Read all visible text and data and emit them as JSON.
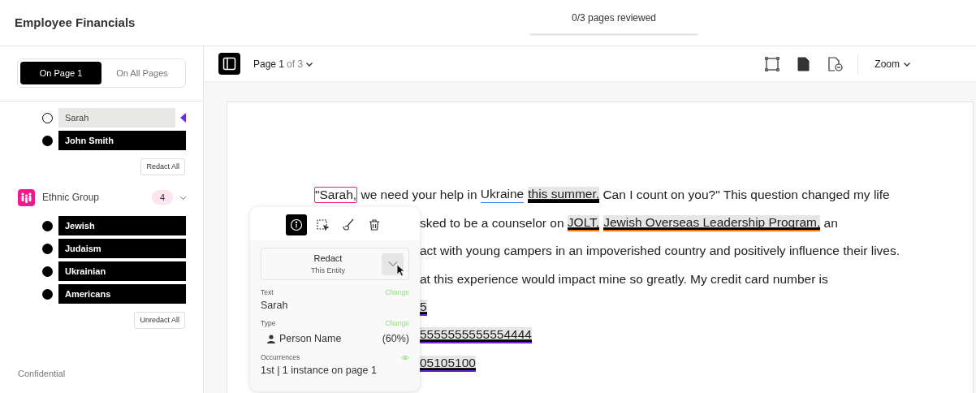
{
  "header": {
    "title": "Employee Financials",
    "review": {
      "label": "0/3 pages reviewed",
      "level": 0
    }
  },
  "sidebar": {
    "scope_tabs": [
      {
        "label": "On Page 1",
        "selected": true
      },
      {
        "label": "On All Pages",
        "selected": false
      }
    ],
    "groups": [
      {
        "items": [
          {
            "label": "Sarah",
            "redacted": false,
            "current": true
          },
          {
            "label": "John Smith",
            "redacted": true,
            "current": false
          }
        ],
        "action": "Redact All"
      },
      {
        "title": "Ethnic Group",
        "count": "4",
        "expanded": true,
        "items": [
          {
            "label": "Jewish",
            "redacted": true,
            "current": false
          },
          {
            "label": "Judaism",
            "redacted": true,
            "current": false
          },
          {
            "label": "Ukrainian",
            "redacted": true,
            "current": false
          },
          {
            "label": "Americans",
            "redacted": true,
            "current": false
          }
        ],
        "action": "Unredact All"
      }
    ],
    "footer": "Confidential"
  },
  "toolbar": {
    "page": "Page 1",
    "of": "of 3",
    "zoom": "Zoom"
  },
  "document": {
    "lines": [
      {
        "covered": false,
        "segments": [
          {
            "kind": "entity",
            "text": "\"Sarah,",
            "selected": true,
            "shaded": false,
            "color": "#e91e8c"
          },
          {
            "kind": "text",
            "text": " we need your help in "
          },
          {
            "kind": "entity",
            "text": "Ukraine",
            "selected": false,
            "shaded": false,
            "color": "#3b82f6"
          },
          {
            "kind": "entity",
            "text": "this summer,",
            "selected": false,
            "shaded": true,
            "color": "#000000"
          },
          {
            "kind": "text",
            "text": " Can I count on you?\" This question changed my life"
          }
        ]
      },
      {
        "covered": true,
        "segments": [
          {
            "kind": "text",
            "text": "sked to be a counselor on "
          },
          {
            "kind": "entity",
            "text": "JOLT,",
            "selected": false,
            "shaded": true,
            "color": "#f97316"
          },
          {
            "kind": "entity",
            "text": "Jewish Overseas Leadership Program,",
            "selected": false,
            "shaded": true,
            "color": "#f97316"
          },
          {
            "kind": "text",
            "text": " an"
          }
        ]
      },
      {
        "covered": true,
        "segments": [
          {
            "kind": "text",
            "text": "act with young campers in an impoverished country and positively influence their lives."
          }
        ]
      },
      {
        "covered": true,
        "segments": [
          {
            "kind": "text",
            "text": "at this experience would impact mine so greatly. My credit card number is"
          }
        ]
      },
      {
        "covered": true,
        "segments": [
          {
            "kind": "entity",
            "text": "5",
            "selected": false,
            "shaded": true,
            "color": "#6d28d9"
          }
        ]
      },
      {
        "covered": true,
        "segments": [
          {
            "kind": "entity",
            "text": "5555555555554444",
            "selected": false,
            "shaded": true,
            "color": "#6d28d9"
          }
        ]
      },
      {
        "covered": true,
        "segments": [
          {
            "kind": "entity",
            "text": "05105100",
            "selected": false,
            "shaded": true,
            "color": "#6d28d9"
          }
        ]
      }
    ]
  },
  "popover": {
    "tools": [
      {
        "kind": "info",
        "selected": true
      },
      {
        "kind": "select",
        "selected": false
      },
      {
        "kind": "brush",
        "selected": false
      },
      {
        "kind": "delete",
        "selected": false
      }
    ],
    "action": {
      "label": "Redact",
      "sub": "This Entity"
    },
    "fields": [
      {
        "kind": "text",
        "label": "Text",
        "link": "Change",
        "value": "Sarah"
      },
      {
        "kind": "type",
        "label": "Type",
        "link": "Change",
        "value": "Person Name",
        "score": "(60%)"
      },
      {
        "kind": "occurrences",
        "label": "Occurrences",
        "value": "1st | 1 instance on page 1"
      }
    ]
  }
}
